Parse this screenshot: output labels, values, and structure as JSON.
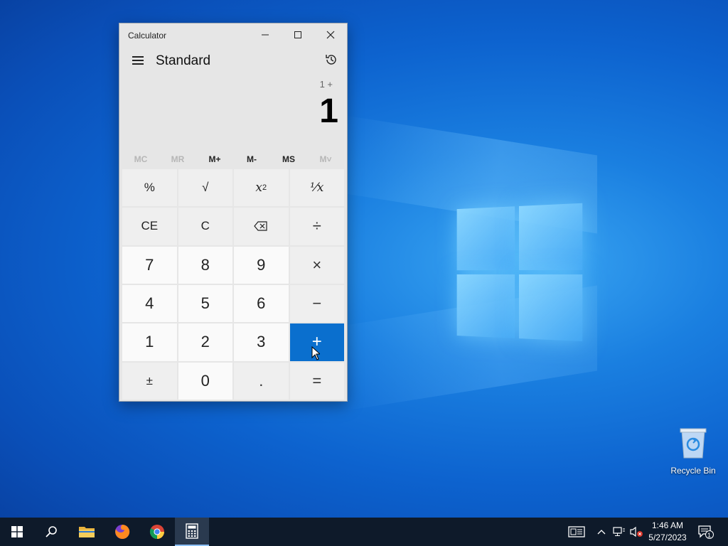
{
  "window": {
    "title": "Calculator",
    "minimize_label": "—",
    "maximize_label": "☐",
    "close_label": "✕"
  },
  "header": {
    "mode": "Standard"
  },
  "display": {
    "expression": "1 +",
    "result": "1"
  },
  "memory": {
    "mc": "MC",
    "mr": "MR",
    "mplus": "M+",
    "mminus": "M-",
    "ms": "MS",
    "mlist": "M˅"
  },
  "keys": {
    "percent": "%",
    "sqrt": "√",
    "square_base": "x",
    "square_exp": "2",
    "reciprocal": "¹⁄x",
    "ce": "CE",
    "c": "C",
    "backspace": "⌫",
    "divide": "÷",
    "seven": "7",
    "eight": "8",
    "nine": "9",
    "multiply": "×",
    "four": "4",
    "five": "5",
    "six": "6",
    "minus": "−",
    "one": "1",
    "two": "2",
    "three": "3",
    "plus": "+",
    "negate": "±",
    "zero": "0",
    "decimal": ".",
    "equals": "="
  },
  "desktop": {
    "recycle_bin_label": "Recycle Bin"
  },
  "taskbar": {
    "time": "1:46 AM",
    "date": "5/27/2023",
    "notification_count": "1"
  },
  "colors": {
    "accent": "#0a6fce",
    "taskbar": "#0e1a2a"
  }
}
